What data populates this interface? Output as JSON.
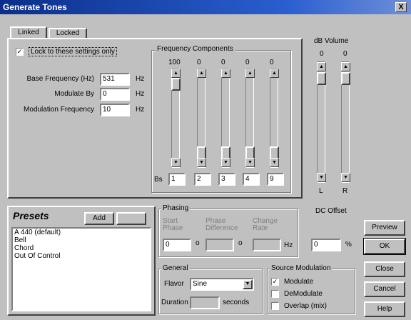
{
  "window": {
    "title": "Generate Tones",
    "close_glyph": "X"
  },
  "tabs": [
    "Linked",
    "Locked"
  ],
  "lock": {
    "label": "Lock to these settings only",
    "checked": true
  },
  "base_freq": {
    "label": "Base Frequency (Hz)",
    "value": "531",
    "unit": "Hz"
  },
  "modulate_by": {
    "label": "Modulate By",
    "value": "0",
    "unit": "Hz"
  },
  "mod_freq": {
    "label": "Modulation Frequency",
    "value": "10",
    "unit": "Hz"
  },
  "freq_components": {
    "title": "Frequency Components",
    "values": [
      "100",
      "0",
      "0",
      "0",
      "0"
    ],
    "levels": [
      100,
      0,
      0,
      0,
      0
    ],
    "prefix": "Bs",
    "multipliers": [
      "1",
      "2",
      "3",
      "4",
      "9"
    ]
  },
  "volume": {
    "title": "dB Volume",
    "left_value": "0",
    "right_value": "0",
    "left_label": "L",
    "right_label": "R"
  },
  "presets": {
    "title": "Presets",
    "add_label": "Add",
    "del_label": "",
    "items": [
      "A 440 (default)",
      "Bell",
      "Chord",
      "Out Of Control"
    ]
  },
  "phasing": {
    "title": "Phasing",
    "start_label": "Start Phase",
    "start_value": "0",
    "start_unit": "o",
    "diff_label": "Phase Difference",
    "diff_value": "",
    "diff_unit": "o",
    "rate_label": "Change Rate",
    "rate_value": "",
    "rate_unit": "Hz"
  },
  "dc_offset": {
    "title": "DC Offset",
    "value": "0",
    "unit": "%"
  },
  "general": {
    "title": "General",
    "flavor_label": "Flavor",
    "flavor_value": "Sine",
    "duration_label": "Duration",
    "duration_value": "",
    "duration_unit": "seconds"
  },
  "source_mod": {
    "title": "Source Modulation",
    "items": [
      {
        "label": "Modulate",
        "checked": true
      },
      {
        "label": "DeModulate",
        "checked": false
      },
      {
        "label": "Overlap (mix)",
        "checked": false
      }
    ]
  },
  "buttons": {
    "preview": "Preview",
    "ok": "OK",
    "close": "Close",
    "cancel": "Cancel",
    "help": "Help"
  }
}
